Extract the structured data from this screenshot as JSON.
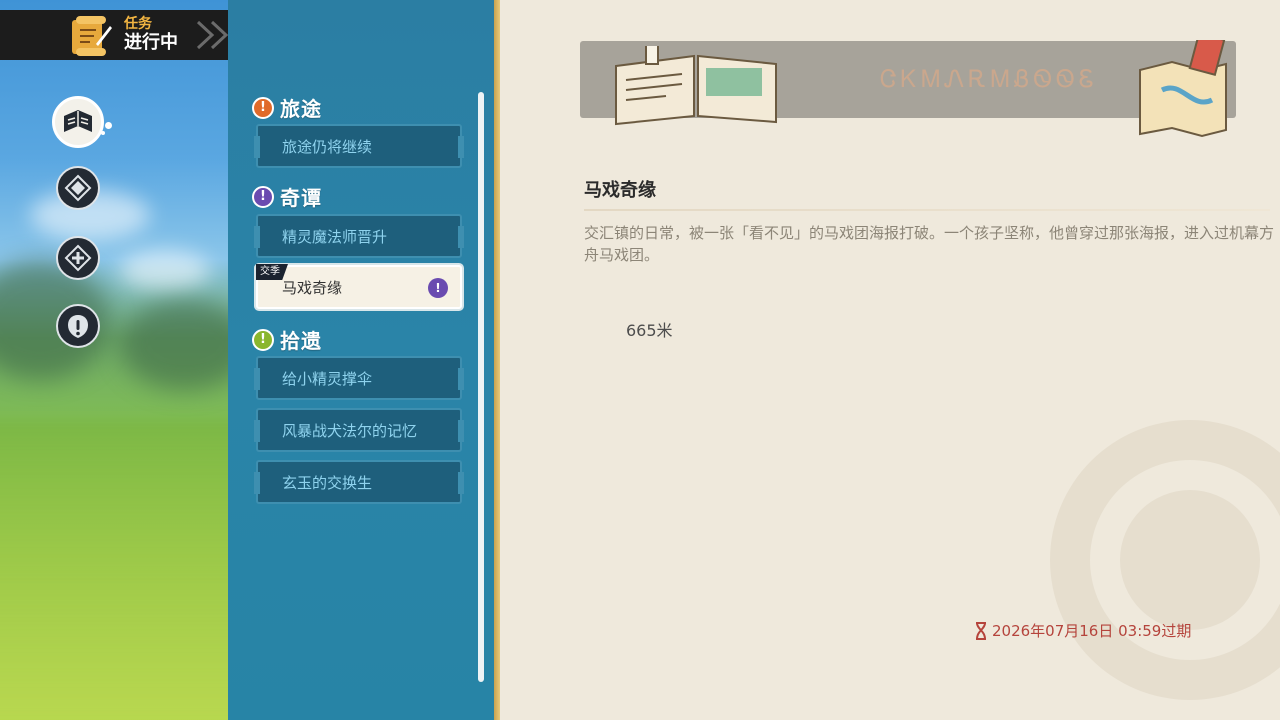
{
  "header": {
    "category": "任务",
    "status": "进行中"
  },
  "categories": [
    {
      "label": "旅途",
      "color": "#e06a2a",
      "items": [
        "旅途仍将继续"
      ]
    },
    {
      "label": "奇谭",
      "color": "#6a4bb0",
      "items": [
        "精灵魔法师晋升",
        "马戏奇缘"
      ]
    },
    {
      "label": "拾遗",
      "color": "#8ab62e",
      "items": [
        "给小精灵撑伞",
        "风暴战犬法尔的记忆",
        "玄玉的交换生"
      ]
    }
  ],
  "selected_tag": "交季",
  "details": {
    "title": "马戏奇缘",
    "description": "交汇镇的日常，被一张「看不见」的马戏团海报打破。一个孩子坚称，他曾穿过那张海报，进入过机幕方舟马戏团。",
    "distance": "665米",
    "expire": "2026年07月16日 03:59过期",
    "banner_runes": "ᏣᏦᎷᏁᎡᎷᏰᏫᏫᏋ"
  }
}
